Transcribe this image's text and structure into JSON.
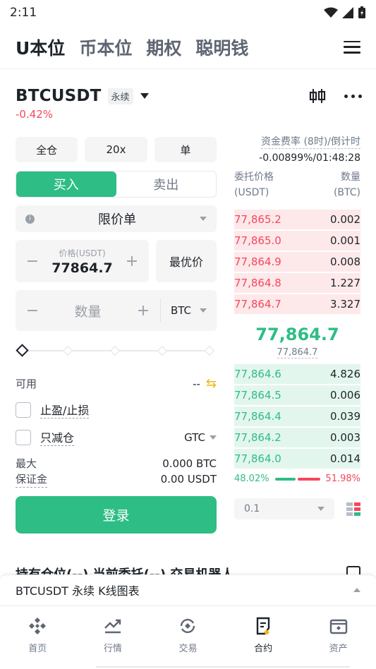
{
  "status": {
    "time": "2:11"
  },
  "top_tabs": [
    "U本位",
    "币本位",
    "期权",
    "聪明钱"
  ],
  "symbol": {
    "name": "BTCUSDT",
    "badge": "永续",
    "change": "-0.42%"
  },
  "controls": {
    "margin_mode": "全仓",
    "leverage": "20x",
    "position_mode": "单"
  },
  "buy_sell": {
    "buy": "买入",
    "sell": "卖出"
  },
  "order_type": "限价单",
  "price_input": {
    "label": "价格(USDT)",
    "value": "77864.7",
    "best_label": "最优价"
  },
  "qty_input": {
    "placeholder": "数量",
    "unit": "BTC"
  },
  "available": {
    "label": "可用",
    "value": "--"
  },
  "tp_sl": "止盈/止损",
  "reduce_only": "只减仓",
  "tif": "GTC",
  "max": {
    "label": "最大",
    "value": "0.000 BTC"
  },
  "margin": {
    "label": "保证金",
    "value": "0.00 USDT"
  },
  "login": "登录",
  "orderbook": {
    "funding_label": "资金费率 (8时)/倒计时",
    "funding_value": "-0.00899%/01:48:28",
    "price_header": "委托价格",
    "price_unit": "(USDT)",
    "qty_header": "数量",
    "qty_unit": "(BTC)",
    "asks": [
      {
        "price": "77,865.2",
        "qty": "0.002",
        "depth": 1.0
      },
      {
        "price": "77,865.0",
        "qty": "0.001",
        "depth": 1.0
      },
      {
        "price": "77,864.9",
        "qty": "0.008",
        "depth": 1.0
      },
      {
        "price": "77,864.8",
        "qty": "1.227",
        "depth": 1.0
      },
      {
        "price": "77,864.7",
        "qty": "3.327",
        "depth": 1.0
      }
    ],
    "last_price": "77,864.7",
    "mark_price": "77,864.7",
    "bids": [
      {
        "price": "77,864.6",
        "qty": "4.826",
        "depth": 1.0
      },
      {
        "price": "77,864.5",
        "qty": "0.006",
        "depth": 1.0
      },
      {
        "price": "77,864.4",
        "qty": "0.039",
        "depth": 1.0
      },
      {
        "price": "77,864.2",
        "qty": "0.003",
        "depth": 1.0
      },
      {
        "price": "77,864.0",
        "qty": "0.014",
        "depth": 1.0
      }
    ],
    "buy_ratio": "48.02%",
    "sell_ratio": "51.98%",
    "buy_ratio_value": 48.02,
    "depth_step": "0.1"
  },
  "positions_peek": "持有仓位(--)  当前委托(--)  交易机器人",
  "kline_bar": "BTCUSDT 永续 K线图表",
  "bottom_nav": [
    {
      "label": "首页",
      "icon": "home-icon"
    },
    {
      "label": "行情",
      "icon": "markets-icon"
    },
    {
      "label": "交易",
      "icon": "trade-icon"
    },
    {
      "label": "合约",
      "icon": "futures-icon"
    },
    {
      "label": "资产",
      "icon": "wallet-icon"
    }
  ],
  "colors": {
    "green": "#2ebd85",
    "red": "#f6465d",
    "accent": "#f0b90b"
  }
}
